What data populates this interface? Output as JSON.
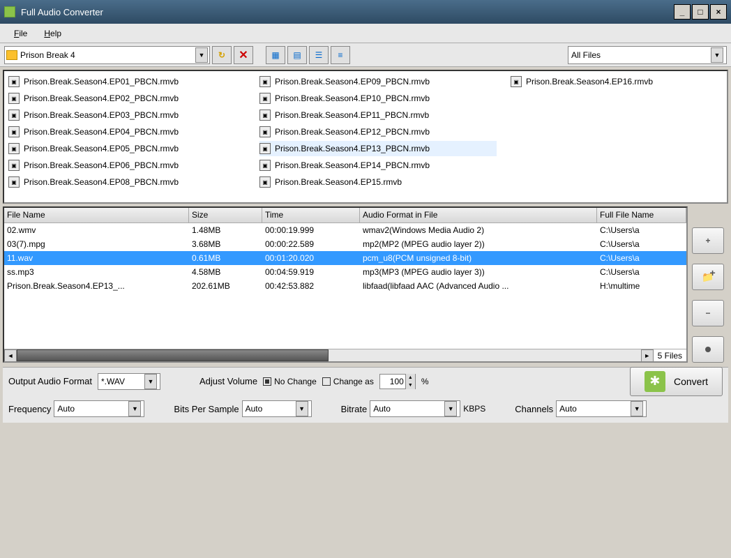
{
  "title": "Full Audio Converter",
  "menu": {
    "file": "File",
    "help": "Help"
  },
  "toolbar": {
    "path": "Prison Break 4",
    "filter": "All Files"
  },
  "browser_files": [
    "Prison.Break.Season4.EP01_PBCN.rmvb",
    "Prison.Break.Season4.EP02_PBCN.rmvb",
    "Prison.Break.Season4.EP03_PBCN.rmvb",
    "Prison.Break.Season4.EP04_PBCN.rmvb",
    "Prison.Break.Season4.EP05_PBCN.rmvb",
    "Prison.Break.Season4.EP06_PBCN.rmvb",
    "Prison.Break.Season4.EP08_PBCN.rmvb",
    "Prison.Break.Season4.EP09_PBCN.rmvb",
    "Prison.Break.Season4.EP10_PBCN.rmvb",
    "Prison.Break.Season4.EP11_PBCN.rmvb",
    "Prison.Break.Season4.EP12_PBCN.rmvb",
    "Prison.Break.Season4.EP13_PBCN.rmvb",
    "Prison.Break.Season4.EP14_PBCN.rmvb",
    "Prison.Break.Season4.EP15.rmvb",
    "Prison.Break.Season4.EP16.rmvb"
  ],
  "browser_selected": 11,
  "queue": {
    "headers": {
      "name": "File Name",
      "size": "Size",
      "time": "Time",
      "format": "Audio Format in File",
      "path": "Full File Name"
    },
    "rows": [
      {
        "name": "02.wmv",
        "size": "1.48MB",
        "time": "00:00:19.999",
        "format": "wmav2(Windows Media Audio 2)",
        "path": "C:\\Users\\a"
      },
      {
        "name": "03(7).mpg",
        "size": "3.68MB",
        "time": "00:00:22.589",
        "format": "mp2(MP2 (MPEG audio layer 2))",
        "path": "C:\\Users\\a"
      },
      {
        "name": "11.wav",
        "size": "0.61MB",
        "time": "00:01:20.020",
        "format": "pcm_u8(PCM unsigned 8-bit)",
        "path": "C:\\Users\\a"
      },
      {
        "name": "ss.mp3",
        "size": "4.58MB",
        "time": "00:04:59.919",
        "format": "mp3(MP3 (MPEG audio layer 3))",
        "path": "C:\\Users\\a"
      },
      {
        "name": "Prison.Break.Season4.EP13_...",
        "size": "202.61MB",
        "time": "00:42:53.882",
        "format": "libfaad(libfaad AAC (Advanced Audio ...",
        "path": "H:\\multime"
      }
    ],
    "selected": 2,
    "count": "5 Files"
  },
  "output": {
    "format_label": "Output Audio Format",
    "format_value": "*.WAV",
    "volume_label": "Adjust Volume",
    "no_change": "No Change",
    "change_as": "Change as",
    "change_value": "100",
    "percent": "%",
    "convert": "Convert"
  },
  "params": {
    "freq_label": "Frequency",
    "freq_value": "Auto",
    "bits_label": "Bits Per Sample",
    "bits_value": "Auto",
    "bitrate_label": "Bitrate",
    "bitrate_value": "Auto",
    "kbps": "KBPS",
    "channels_label": "Channels",
    "channels_value": "Auto"
  }
}
